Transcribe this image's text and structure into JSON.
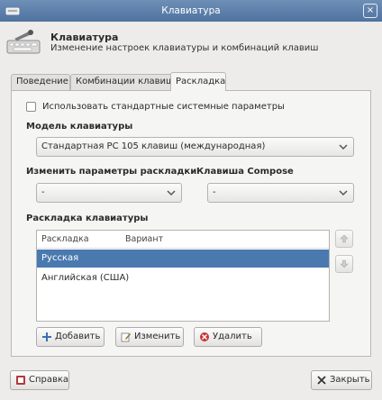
{
  "window": {
    "title": "Клавиатура",
    "close_glyph": "×"
  },
  "header": {
    "title": "Клавиатура",
    "subtitle": "Изменение настроек клавиатуры и комбинаций клавиш"
  },
  "tabs": [
    {
      "label": "Поведение"
    },
    {
      "label": "Комбинации клавиш"
    },
    {
      "label": "Раскладка"
    }
  ],
  "layout_tab": {
    "use_system_defaults_label": "Использовать стандартные системные параметры",
    "model_label": "Модель клавиатуры",
    "model_value": "Стандартная PC 105 клавиш (международная)",
    "change_layout_label": "Изменить параметры раскладки",
    "change_layout_value": "-",
    "compose_label": "Клавиша Compose",
    "compose_value": "-",
    "layouts_label": "Раскладка клавиатуры",
    "columns": {
      "layout": "Раскладка",
      "variant": "Вариант"
    },
    "rows": [
      {
        "layout": "Русская",
        "selected": true
      },
      {
        "layout": "Английская (США)",
        "selected": false
      }
    ],
    "add_label": "Добавить",
    "edit_label": "Изменить",
    "remove_label": "Удалить"
  },
  "footer": {
    "help_label": "Справка",
    "close_label": "Закрыть"
  },
  "colors": {
    "titlebar": "#5a7dab",
    "selection": "#4a79b0"
  }
}
